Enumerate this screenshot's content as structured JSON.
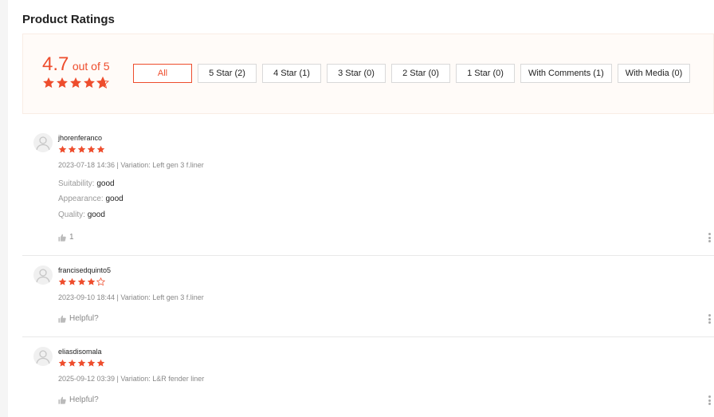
{
  "section_title": "Product Ratings",
  "summary": {
    "score": "4.7",
    "out_of": "out of 5",
    "rating": 4.7,
    "max_rating": 5,
    "star_color": "#ee4d2d"
  },
  "filters": [
    "All",
    "5 Star (2)",
    "4 Star (1)",
    "3 Star (0)",
    "2 Star (0)",
    "1 Star (0)",
    "With Comments (1)",
    "With Media (0)"
  ],
  "active_filter": "All",
  "reviews": [
    {
      "user": "jhorenferanco",
      "stars": 5,
      "meta": "2023-07-18 14:36 | Variation: Left gen 3 f.liner",
      "attributes": [
        {
          "label": "Suitability:",
          "value": "good"
        },
        {
          "label": "Appearance:",
          "value": "good"
        },
        {
          "label": "Quality:",
          "value": "good"
        }
      ],
      "likes": "1"
    },
    {
      "user": "francisedquinto5",
      "stars": 4,
      "meta": "2023-09-10 18:44 | Variation: Left gen 3 f.liner",
      "attributes": [],
      "likes": "Helpful?"
    },
    {
      "user": "eliasdisomala",
      "stars": 5,
      "meta": "2025-09-12 03:39 | Variation: L&R fender liner",
      "attributes": [],
      "likes": "Helpful?"
    }
  ]
}
